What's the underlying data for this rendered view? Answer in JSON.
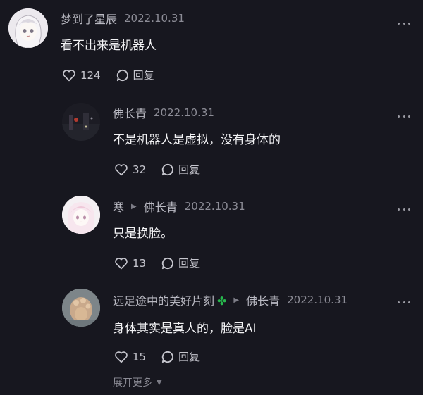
{
  "comments": [
    {
      "author": "梦到了星辰",
      "date": "2022.10.31",
      "text": "看不出来是机器人",
      "likes": "124",
      "reply_label": "回复"
    },
    {
      "author": "佛长青",
      "date": "2022.10.31",
      "text": "不是机器人是虚拟，没有身体的",
      "likes": "32",
      "reply_label": "回复"
    },
    {
      "author": "寒",
      "reply_to": "佛长青",
      "date": "2022.10.31",
      "text": "只是换脸。",
      "likes": "13",
      "reply_label": "回复"
    },
    {
      "author": "远足途中的美好片刻",
      "author_emoji": "✤",
      "reply_to": "佛长青",
      "date": "2022.10.31",
      "text": "身体其实是真人的，脸是AI",
      "likes": "15",
      "reply_label": "回复"
    }
  ],
  "expand_more_label": "展开更多",
  "colors": {
    "background": "#17171f",
    "clover": "#27b84d"
  }
}
